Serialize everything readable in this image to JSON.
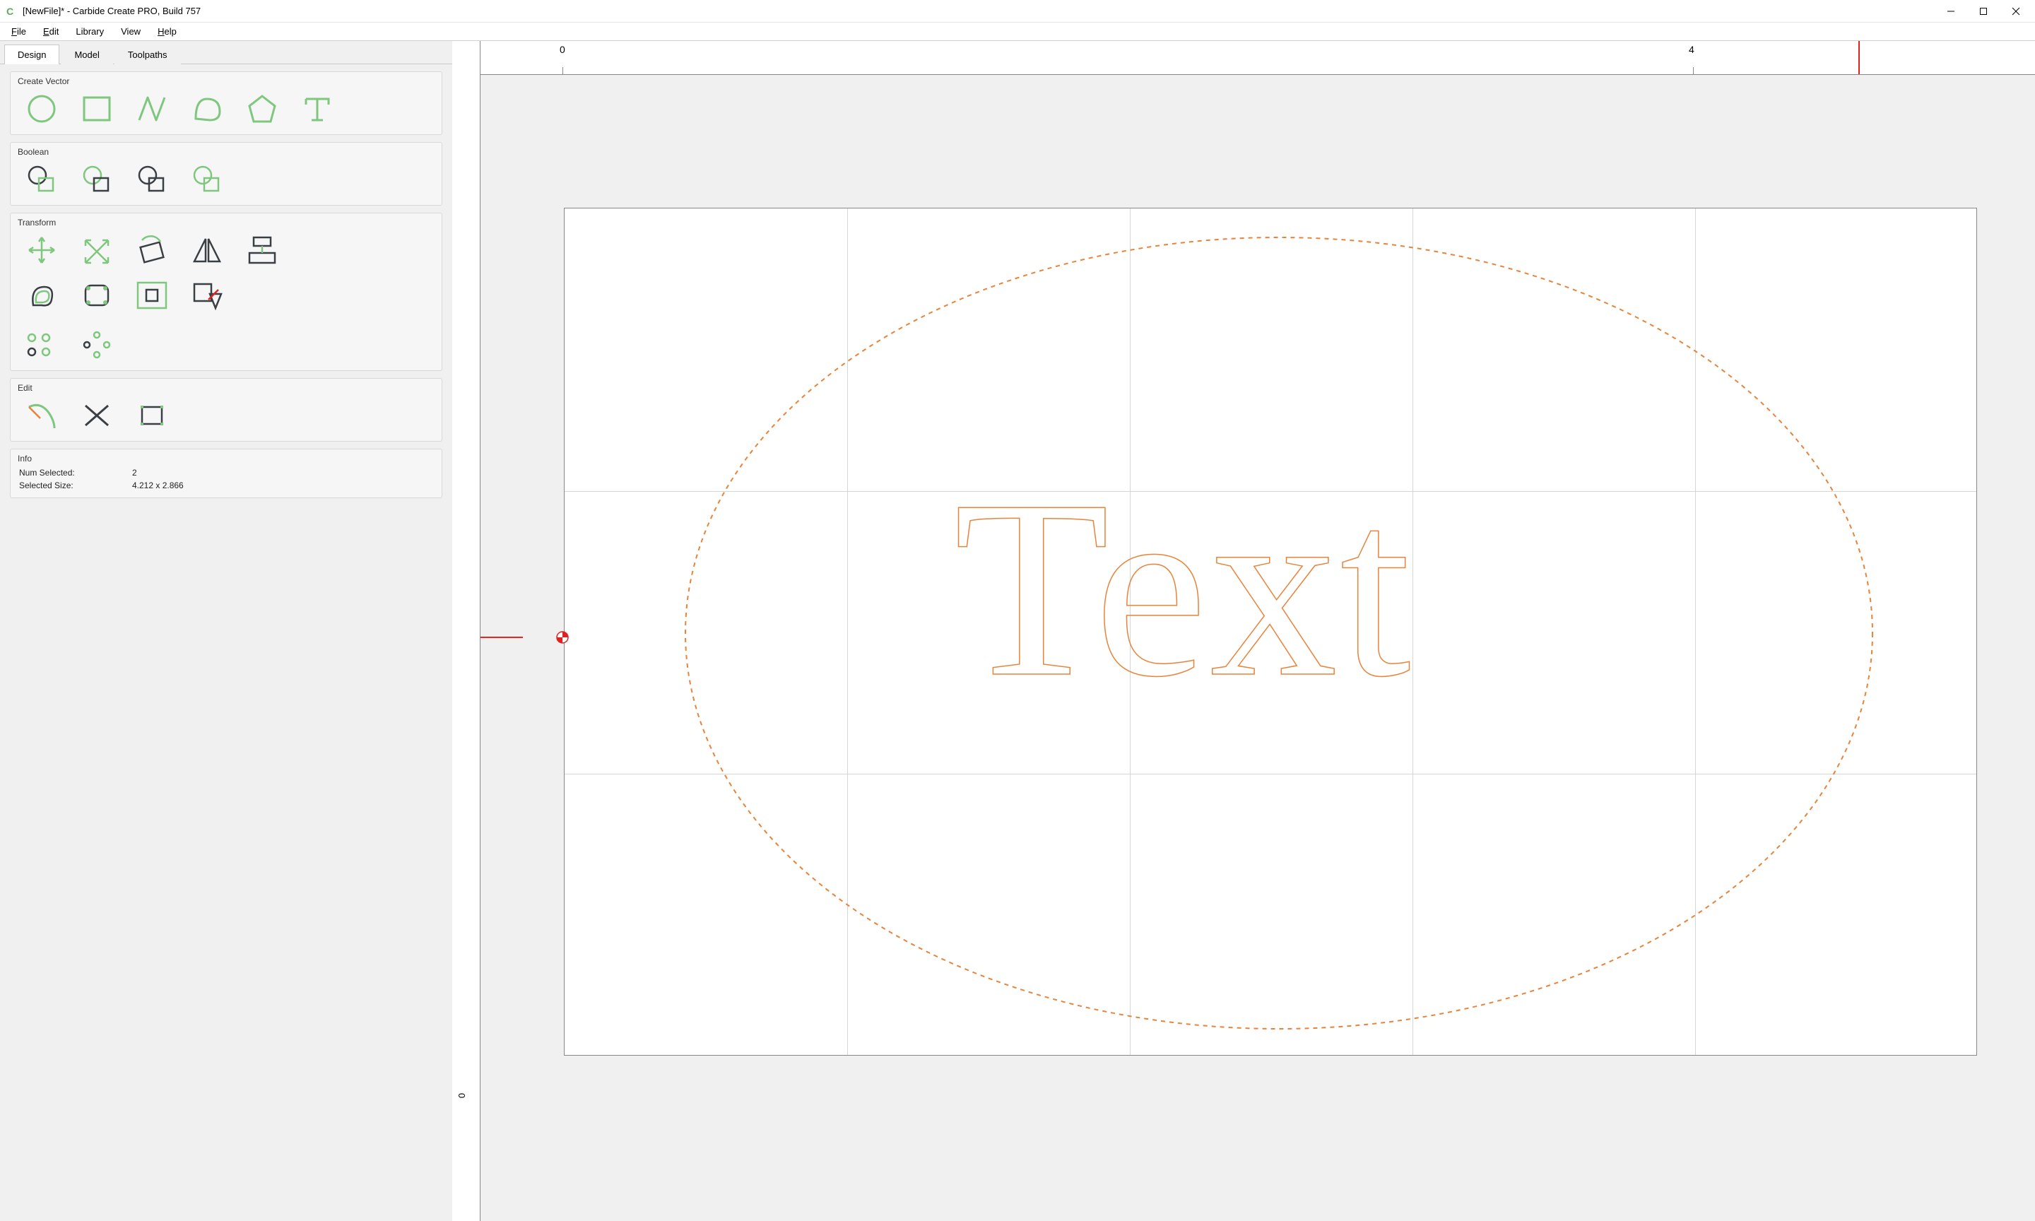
{
  "window": {
    "title": "[NewFile]* - Carbide Create PRO, Build 757",
    "app_icon_glyph": "C"
  },
  "menu": {
    "file": "File",
    "edit": "Edit",
    "library": "Library",
    "view": "View",
    "help": "Help"
  },
  "tabs": {
    "design": "Design",
    "model": "Model",
    "toolpaths": "Toolpaths"
  },
  "groups": {
    "create_vector": "Create Vector",
    "boolean": "Boolean",
    "transform": "Transform",
    "edit": "Edit",
    "info": "Info"
  },
  "info": {
    "num_selected_label": "Num Selected:",
    "num_selected_value": "2",
    "selected_size_label": "Selected Size:",
    "selected_size_value": "4.212 x 2.866"
  },
  "ruler": {
    "h_labels": [
      "0",
      "4"
    ],
    "v_labels": [
      "0"
    ]
  },
  "canvas": {
    "text_content": "Text"
  },
  "colors": {
    "tool_green": "#7fc77f",
    "tool_dark": "#3a3f44",
    "selection_orange": "#e8833a",
    "crosshair_red": "#e22020"
  }
}
